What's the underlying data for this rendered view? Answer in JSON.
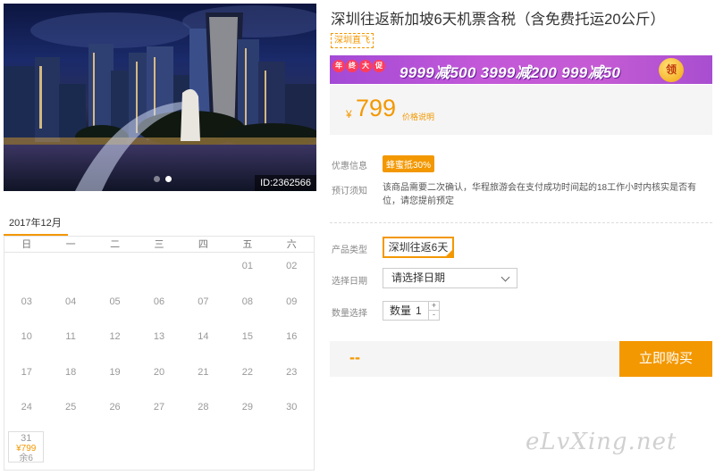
{
  "hero": {
    "image_id": "ID:2362566",
    "slides": 2,
    "active_slide": 1
  },
  "calendar": {
    "month_tab": "2017年12月",
    "weekdays": [
      "日",
      "一",
      "二",
      "三",
      "四",
      "五",
      "六"
    ],
    "weeks": [
      [
        "",
        "",
        "",
        "",
        "",
        "01",
        "02"
      ],
      [
        "03",
        "04",
        "05",
        "06",
        "07",
        "08",
        "09"
      ],
      [
        "10",
        "11",
        "12",
        "13",
        "14",
        "15",
        "16"
      ],
      [
        "17",
        "18",
        "19",
        "20",
        "21",
        "22",
        "23"
      ],
      [
        "24",
        "25",
        "26",
        "27",
        "28",
        "29",
        "30"
      ]
    ],
    "priced_day": {
      "day": "31",
      "price": "¥799",
      "stock": "余6"
    }
  },
  "product": {
    "title": "深圳往返新加坡6天机票含税（含免费托运20公斤）",
    "tag": "深圳直飞",
    "promo": {
      "badge": [
        "年",
        "终",
        "大",
        "促"
      ],
      "text": "9999减500  3999减200  999减50",
      "coin": "领"
    },
    "price": {
      "currency": "¥",
      "value": "799",
      "note": "价格说明"
    },
    "offer_label": "优惠信息",
    "offer_badge": "蜂蜜抵30%",
    "notice_label": "预订须知",
    "notice_text": "该商品需要二次确认，华程旅游会在支付成功时间起的18工作小时内核实是否有位，请您提前预定",
    "type_label": "产品类型",
    "type_value": "深圳往返6天",
    "date_label": "选择日期",
    "date_placeholder": "请选择日期",
    "qty_label": "数量选择",
    "qty_inner_label": "数量",
    "qty_value": "1",
    "qty_plus": "+",
    "qty_minus": "-"
  },
  "buy": {
    "total": "--",
    "button": "立即购买"
  },
  "watermark": "eLvXing.net"
}
